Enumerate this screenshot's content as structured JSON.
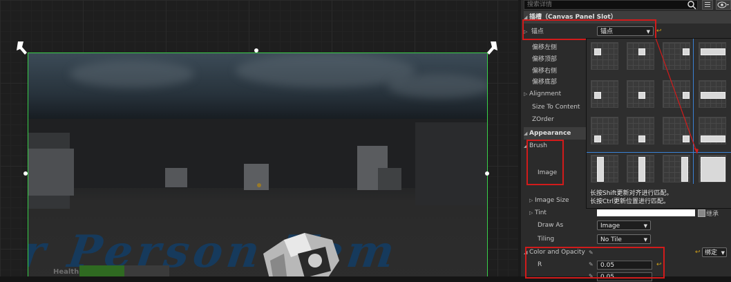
{
  "viewport": {
    "background_text": "r Person Tem",
    "hud_health_label": "Health",
    "health_fraction": 0.5
  },
  "details": {
    "search_placeholder": "搜索详情",
    "slot_category": "插槽（Canvas Panel Slot）",
    "anchor_label": "锚点",
    "anchor_value": "锚点",
    "properties": [
      "偏移左侧",
      "偏移顶部",
      "偏移右侧",
      "偏移底部",
      "Alignment",
      "Size To Content",
      "ZOrder"
    ],
    "appearance_category": "Appearance",
    "brush_label": "Brush",
    "image_label": "Image",
    "image_size_label": "Image Size",
    "tint_label": "Tint",
    "tint_inherit": "继承",
    "draw_as_label": "Draw As",
    "draw_as_value": "Image",
    "tiling_label": "Tiling",
    "tiling_value": "No Tile",
    "color_opacity_label": "Color and Opacity",
    "bind_label": "绑定",
    "r_label": "R",
    "r_value": "0.05",
    "g_value": "0.05"
  },
  "anchor_popup": {
    "hint_line1": "长按Shift更新对齐进行匹配。",
    "hint_line2": "长按Ctrl更新位置进行匹配。"
  },
  "colors": {
    "selection_outline": "#39d24a",
    "annotation_red": "#d21b1b",
    "reset_arrow": "#d2a21a",
    "anchor_guide": "#3a82d6"
  },
  "icons": [
    "search-icon",
    "grid-view-icon",
    "eye-icon",
    "reset-arrow-icon",
    "eyedropper-icon",
    "chevron-down-icon"
  ]
}
